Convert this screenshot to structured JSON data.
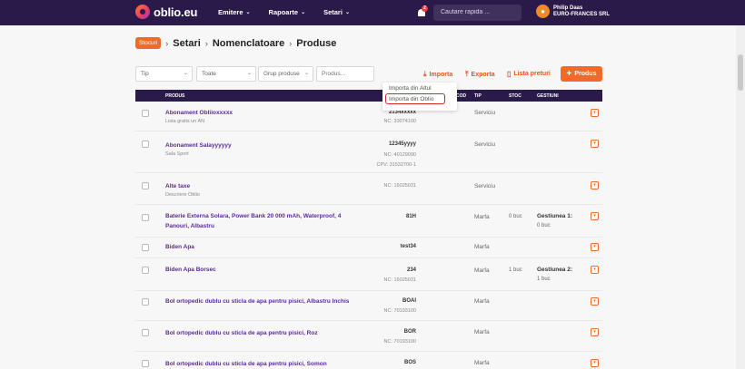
{
  "brand": {
    "name": "oblio.eu"
  },
  "nav": [
    {
      "label": "Emitere"
    },
    {
      "label": "Rapoarte"
    },
    {
      "label": "Setari"
    }
  ],
  "notifications": {
    "count": "2",
    "icon": "bell-icon"
  },
  "search": {
    "placeholder": "Cautare rapida ..."
  },
  "user": {
    "name": "Philip Daas",
    "company": "EURO-FRANCES SRL",
    "avatar_icon": "user-icon"
  },
  "breadcrumb": {
    "badge": "Stocuri",
    "items": [
      "Setari",
      "Nomenclatoare",
      "Produse"
    ]
  },
  "filters": {
    "tip": "Tip",
    "toate": "Toate",
    "grup": "Grup produse",
    "produs_placeholder": "Produs..."
  },
  "actions": {
    "import": "Importa",
    "export": "Exporta",
    "price_list": "Lista preturi",
    "add_product": "Produs"
  },
  "import_menu": {
    "item1": "Importa din Altul",
    "item2": "Importa din Oblio"
  },
  "table": {
    "headers": {
      "produs": "PRODUS",
      "cod": "COD",
      "tip": "TIP",
      "stoc": "STOC",
      "gestiuni": "GESTIUNI"
    },
    "rows": [
      {
        "name": "Abonament Obliioxxxxx",
        "desc": "Lista gratis un AN",
        "code": "2134xxxxx",
        "nc": "NC: 33074100",
        "tip": "Serviciu"
      },
      {
        "name": "Abonament Salayyyyyy",
        "desc": "Sala Sport",
        "code": "12345yyyy",
        "nc": "NC: 40129090",
        "cpv": "CPV: 31532700-1",
        "tip": "Serviciu"
      },
      {
        "name": "Alte taxe",
        "desc": "Descriere Oblio",
        "code": "",
        "nc": "NC: 16025031",
        "tip": "Serviciu"
      },
      {
        "name": "Baterie Externa Solara, Power Bank 20 000 mAh, Waterproof, 4 Panouri, Albastru",
        "code": "81H",
        "tip": "Marfa",
        "stoc": "0 buc",
        "gest": "Gestiunea 1:",
        "gestv": "0 buc"
      },
      {
        "name": "Biden Apa",
        "code": "test34",
        "tip": "Marfa"
      },
      {
        "name": "Biden Apa Borsec",
        "code": "234",
        "nc": "NC: 16025031",
        "tip": "Marfa",
        "stoc": "1 buc",
        "gest": "Gestiunea 2:",
        "gestv": "1 buc"
      },
      {
        "name": "Bol ortopedic dublu cu sticla de apa pentru pisici, Albastru Inchis",
        "code": "BOAI",
        "nc": "NC: 70193100",
        "tip": "Marfa"
      },
      {
        "name": "Bol ortopedic dublu cu sticla de apa pentru pisici, Roz",
        "code": "BOR",
        "nc": "NC: 70193100",
        "tip": "Marfa"
      },
      {
        "name": "Bol ortopedic dublu cu sticla de apa pentru pisici, Somon",
        "code": "BOS",
        "tip": "Marfa"
      }
    ]
  },
  "colors": {
    "accent": "#f26a2a",
    "nav_bg": "#2a1a49",
    "link": "#5b2a9c",
    "highlight": "#d6252b"
  }
}
